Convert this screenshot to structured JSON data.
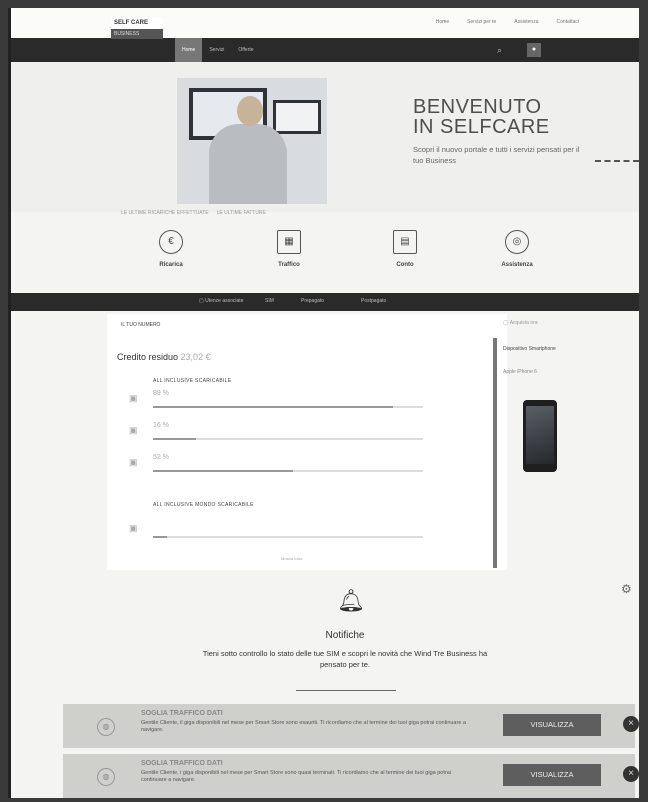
{
  "top_links": [
    "Home",
    "Servizi per te",
    "Assistenza",
    "Contattaci"
  ],
  "logo": {
    "line1": "SELF CARE",
    "line2": "BUSINESS"
  },
  "nav": {
    "tabs": [
      "Home",
      "Servizi",
      "Offerte"
    ]
  },
  "hero": {
    "title_line1": "BENVENUTO",
    "title_line2": "IN SELFCARE",
    "text": "Scopri il nuovo portale e tutti i servizi pensati per il tuo Business",
    "links": [
      "LE ULTIME RICARICHE EFFETTUATE",
      "LE ULTIME FATTURE"
    ]
  },
  "quick_actions": [
    {
      "label": "Ricarica",
      "icon": "euro-coin-icon"
    },
    {
      "label": "Traffico",
      "icon": "traffic-building-icon"
    },
    {
      "label": "Conto",
      "icon": "document-icon"
    },
    {
      "label": "Assistenza",
      "icon": "lifebuoy-icon"
    }
  ],
  "filterbar": {
    "label": "Utenze associate",
    "items": [
      "SIM",
      "Prepagato",
      "Postpagato"
    ]
  },
  "panel": {
    "head": "IL TUO NUMERO",
    "credit_label": "Credito residuo",
    "credit_value": "23,02 €",
    "section1": "ALL INCLUSIVE SCARICABILE",
    "rows1": [
      {
        "value": "89 %",
        "fill": 0.89
      },
      {
        "value": "16 %",
        "fill": 0.16
      },
      {
        "value": "52 %",
        "fill": 0.52
      }
    ],
    "section2": "ALL INCLUSIVE MONDO SCARICABILE",
    "rows2": [
      {
        "value": "",
        "fill": 0.05
      }
    ],
    "more": "Mostra tutto"
  },
  "side": {
    "title": "Acquista ora",
    "headline": "Dispositivo Smartphone",
    "model": "Apple iPhone 6"
  },
  "notifications": {
    "title": "Notifiche",
    "text": "Tieni sotto controllo lo stato delle tue SIM e scopri le novità che Wind Tre Business ha pensato per te.",
    "cards": [
      {
        "title": "SOGLIA TRAFFICO DATI",
        "body": "Gentile Cliente, il giga disponibili nel mese per Smart Store sono esauriti. Ti ricordiamo che al termine dei tuoi giga potrai continuare a navigare.",
        "button": "VISUALIZZA"
      },
      {
        "title": "SOGLIA TRAFFICO DATI",
        "body": "Gentile Cliente, i giga disponibili nel mese per Smart Store sono quasi terminati. Ti ricordiamo che al termine dei tuoi giga potrai continuare a navigare.",
        "button": "VISUALIZZA"
      }
    ]
  }
}
